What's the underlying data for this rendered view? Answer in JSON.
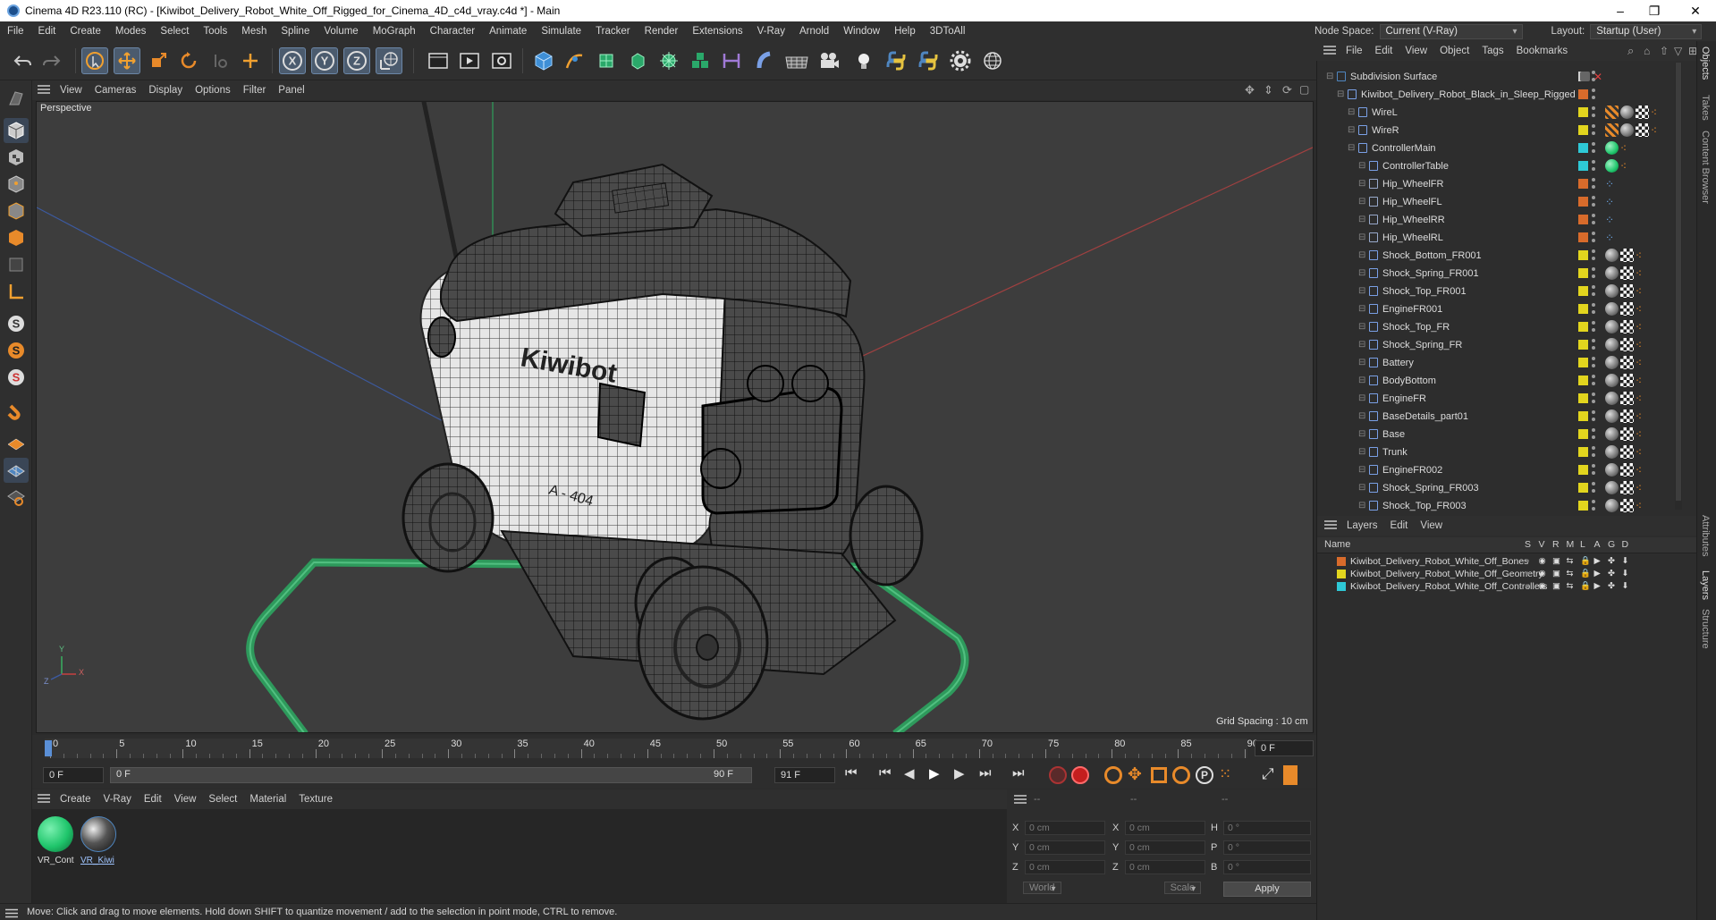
{
  "window": {
    "title": "Cinema 4D R23.110 (RC) - [Kiwibot_Delivery_Robot_White_Off_Rigged_for_Cinema_4D_c4d_vray.c4d *] - Main",
    "controls": [
      "–",
      "❐",
      "✕"
    ]
  },
  "menubar": {
    "items": [
      "File",
      "Edit",
      "Create",
      "Modes",
      "Select",
      "Tools",
      "Mesh",
      "Spline",
      "Volume",
      "MoGraph",
      "Character",
      "Animate",
      "Simulate",
      "Tracker",
      "Render",
      "Extensions",
      "V-Ray",
      "Arnold",
      "Window",
      "Help",
      "3DToAll"
    ],
    "node_space_label": "Node Space:",
    "node_space_value": "Current (V-Ray)",
    "layout_label": "Layout:",
    "layout_value": "Startup (User)"
  },
  "viewport": {
    "menu": [
      "View",
      "Cameras",
      "Display",
      "Options",
      "Filter",
      "Panel"
    ],
    "label": "Perspective",
    "grid_spacing": "Grid Spacing : 10 cm",
    "axis_z": "Z",
    "axis_y": "Y",
    "axis_x": "X",
    "logo_text": "Kiwibot",
    "plate_text": "A - 404"
  },
  "timeline": {
    "ticks": [
      "0",
      "5",
      "10",
      "15",
      "20",
      "25",
      "30",
      "35",
      "40",
      "45",
      "50",
      "55",
      "60",
      "65",
      "70",
      "75",
      "80",
      "85",
      "90"
    ],
    "current_frame": "0 F",
    "start_field": "0 F",
    "range_start": "0 F",
    "range_end": "90 F",
    "end_field": "91 F"
  },
  "materials": {
    "menu": [
      "Create",
      "V-Ray",
      "Edit",
      "View",
      "Select",
      "Material",
      "Texture"
    ],
    "items": [
      {
        "name": "VR_Cont",
        "color": "#1fc56b"
      },
      {
        "name": "VR_Kiwi",
        "color": "#3a3a3a"
      }
    ]
  },
  "coords": {
    "header": [
      "--",
      "--",
      "--"
    ],
    "rows": [
      {
        "a": "X",
        "av": "0 cm",
        "b": "X",
        "bv": "0 cm",
        "c": "H",
        "cv": "0 °"
      },
      {
        "a": "Y",
        "av": "0 cm",
        "b": "Y",
        "bv": "0 cm",
        "c": "P",
        "cv": "0 °"
      },
      {
        "a": "Z",
        "av": "0 cm",
        "b": "Z",
        "bv": "0 cm",
        "c": "B",
        "cv": "0 °"
      }
    ],
    "mode": "World",
    "scale": "Scale",
    "apply": "Apply"
  },
  "status": "Move: Click and drag to move elements. Hold down SHIFT to quantize movement / add to the selection in point mode, CTRL to remove.",
  "objects": {
    "menu": [
      "File",
      "Edit",
      "View",
      "Object",
      "Tags",
      "Bookmarks"
    ],
    "rows": [
      {
        "name": "Subdivision Surface",
        "indent": 0,
        "color": "#cfcfcf",
        "tags": "none"
      },
      {
        "name": "Kiwibot_Delivery_Robot_Black_in_Sleep_Rigged",
        "indent": 1,
        "color": "#d86b2b",
        "tags": "none"
      },
      {
        "name": "WireL",
        "indent": 2,
        "color": "#e2d51e",
        "tags": "mat3"
      },
      {
        "name": "WireR",
        "indent": 2,
        "color": "#e2d51e",
        "tags": "mat3"
      },
      {
        "name": "ControllerMain",
        "indent": 2,
        "color": "#2ec9d6",
        "tags": "green"
      },
      {
        "name": "ControllerTable",
        "indent": 3,
        "color": "#2ec9d6",
        "tags": "green"
      },
      {
        "name": "Hip_WheelFR",
        "indent": 3,
        "color": "#d86b2b",
        "tags": "dots"
      },
      {
        "name": "Hip_WheelFL",
        "indent": 3,
        "color": "#d86b2b",
        "tags": "dots"
      },
      {
        "name": "Hip_WheelRR",
        "indent": 3,
        "color": "#d86b2b",
        "tags": "dots"
      },
      {
        "name": "Hip_WheelRL",
        "indent": 3,
        "color": "#d86b2b",
        "tags": "dots"
      },
      {
        "name": "Shock_Bottom_FR001",
        "indent": 3,
        "color": "#e2d51e",
        "tags": "mat2"
      },
      {
        "name": "Shock_Spring_FR001",
        "indent": 3,
        "color": "#e2d51e",
        "tags": "mat2"
      },
      {
        "name": "Shock_Top_FR001",
        "indent": 3,
        "color": "#e2d51e",
        "tags": "mat2"
      },
      {
        "name": "EngineFR001",
        "indent": 3,
        "color": "#e2d51e",
        "tags": "mat2"
      },
      {
        "name": "Shock_Top_FR",
        "indent": 3,
        "color": "#e2d51e",
        "tags": "mat2"
      },
      {
        "name": "Shock_Spring_FR",
        "indent": 3,
        "color": "#e2d51e",
        "tags": "mat2"
      },
      {
        "name": "Battery",
        "indent": 3,
        "color": "#e2d51e",
        "tags": "mat2"
      },
      {
        "name": "BodyBottom",
        "indent": 3,
        "color": "#e2d51e",
        "tags": "mat2"
      },
      {
        "name": "EngineFR",
        "indent": 3,
        "color": "#e2d51e",
        "tags": "mat2"
      },
      {
        "name": "BaseDetails_part01",
        "indent": 3,
        "color": "#e2d51e",
        "tags": "mat2"
      },
      {
        "name": "Base",
        "indent": 3,
        "color": "#e2d51e",
        "tags": "mat2"
      },
      {
        "name": "Trunk",
        "indent": 3,
        "color": "#e2d51e",
        "tags": "mat2"
      },
      {
        "name": "EngineFR002",
        "indent": 3,
        "color": "#e2d51e",
        "tags": "mat2"
      },
      {
        "name": "Shock_Spring_FR003",
        "indent": 3,
        "color": "#e2d51e",
        "tags": "mat2"
      },
      {
        "name": "Shock_Top_FR003",
        "indent": 3,
        "color": "#e2d51e",
        "tags": "mat2"
      }
    ]
  },
  "layers": {
    "menu": [
      "Layers",
      "Edit",
      "View"
    ],
    "header_name": "Name",
    "header_flags": [
      "S",
      "V",
      "R",
      "M",
      "L",
      "A",
      "G",
      "D"
    ],
    "rows": [
      {
        "name": "Kiwibot_Delivery_Robot_White_Off_Bones",
        "color": "#d86b2b"
      },
      {
        "name": "Kiwibot_Delivery_Robot_White_Off_Geometry",
        "color": "#e2d51e"
      },
      {
        "name": "Kiwibot_Delivery_Robot_White_Off_Controllers",
        "color": "#2ec9d6"
      }
    ]
  },
  "side_tabs": [
    "Objects",
    "Takes",
    "Content Browser",
    "Attributes",
    "Layers",
    "Structure"
  ]
}
